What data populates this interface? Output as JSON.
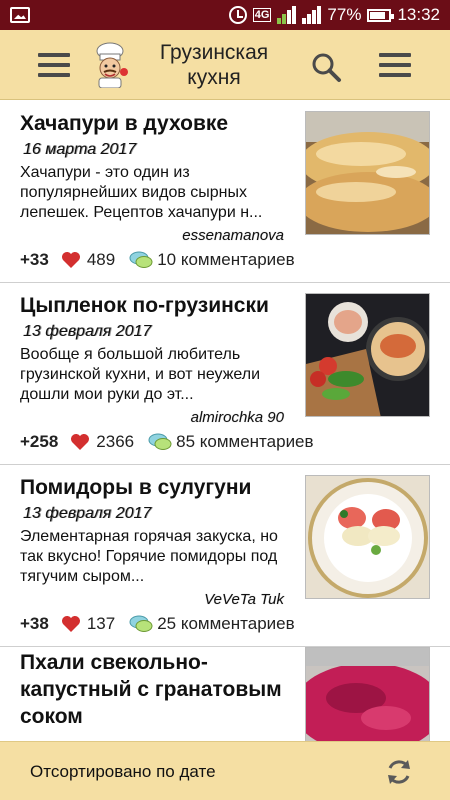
{
  "status_bar": {
    "network": "4G",
    "battery": "77%",
    "time": "13:32"
  },
  "header": {
    "title": "Грузинская кухня",
    "left_icon": "hamburger-menu-icon",
    "logo_icon": "chef-icon",
    "search_icon": "search-icon",
    "right_icon": "list-menu-icon",
    "background_color": "#f5dfa3"
  },
  "recipes": [
    {
      "title": "Хачапури в духовке",
      "date": "16 марта 2017",
      "excerpt": "Хачапури - это один из популярнейших видов сырных лепешек. Рецептов хачапури н...",
      "author": "essenamanova",
      "karma": "+33",
      "likes": "489",
      "comments": "10 комментариев"
    },
    {
      "title": "Цыпленок по-грузински",
      "date": "13 февраля 2017",
      "excerpt": "Вообще я большой любитель грузинской кухни, и вот неужели дошли мои руки до эт...",
      "author": "almirochka 90",
      "karma": "+258",
      "likes": "2366",
      "comments": "85 комментариев"
    },
    {
      "title": "Помидоры в сулугуни",
      "date": "13 февраля 2017",
      "excerpt": "Элементарная горячая закуска, но так вкусно! Горячие помидоры под тягучим сыром...",
      "author": "VeVeTa Tuk",
      "karma": "+38",
      "likes": "137",
      "comments": "25 комментариев"
    },
    {
      "title": "Пхали свекольно-капустный с гранатовым соком"
    }
  ],
  "bottom_bar": {
    "sort_label": "Отсортировано по дате",
    "refresh_icon": "refresh-icon"
  },
  "colors": {
    "status_bar": "#6b0d17",
    "accent": "#f5dfa3",
    "heart": "#d32f2f"
  }
}
